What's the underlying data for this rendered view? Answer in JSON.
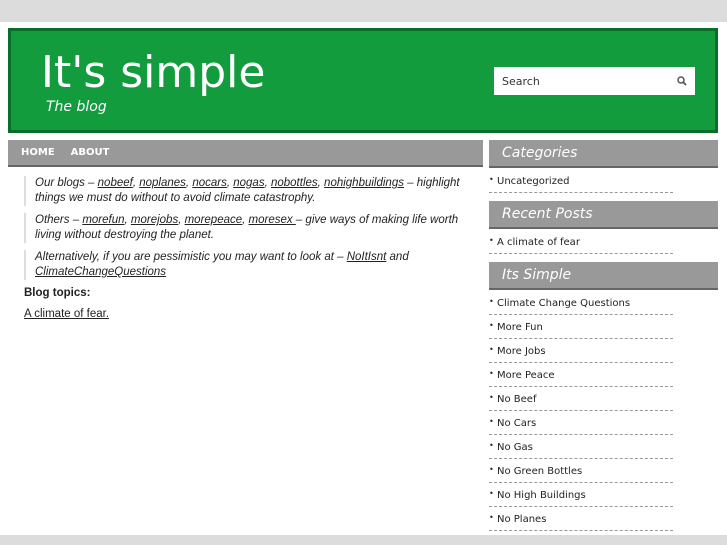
{
  "header": {
    "title": "It's simple",
    "tagline": "The blog",
    "search_placeholder": "Search"
  },
  "nav": [
    {
      "label": "HOME"
    },
    {
      "label": "ABOUT"
    }
  ],
  "content": {
    "q1": {
      "pre": "Our blogs – ",
      "links": [
        "nobeef",
        "noplanes",
        "nocars",
        "nogas",
        "nobottles",
        "nohighbuildings"
      ],
      "post": " – highlight things we must do without to avoid climate catastrophy."
    },
    "q2": {
      "pre": "Others – ",
      "links": [
        "morefun",
        "morejobs",
        "morepeace",
        "moresex "
      ],
      "post": "– give ways of making life worth living without destroying the planet."
    },
    "q3": {
      "pre": "Alternatively, if you are pessimistic you may want to look at – ",
      "link1": "NoItIsnt",
      "mid": " and ",
      "link2": "ClimateChangeQuestions"
    },
    "topics_label": "Blog topics:",
    "topic_link": "A climate of fear."
  },
  "sidebar": [
    {
      "title": "Categories",
      "items": [
        "Uncategorized"
      ]
    },
    {
      "title": "Recent Posts",
      "items": [
        "A climate of fear"
      ]
    },
    {
      "title": "Its Simple",
      "items": [
        "Climate Change Questions",
        "More Fun",
        "More Jobs",
        "More Peace",
        "No Beef",
        "No Cars",
        "No Gas",
        "No Green Bottles",
        "No High Buildings",
        "No Planes"
      ]
    }
  ]
}
